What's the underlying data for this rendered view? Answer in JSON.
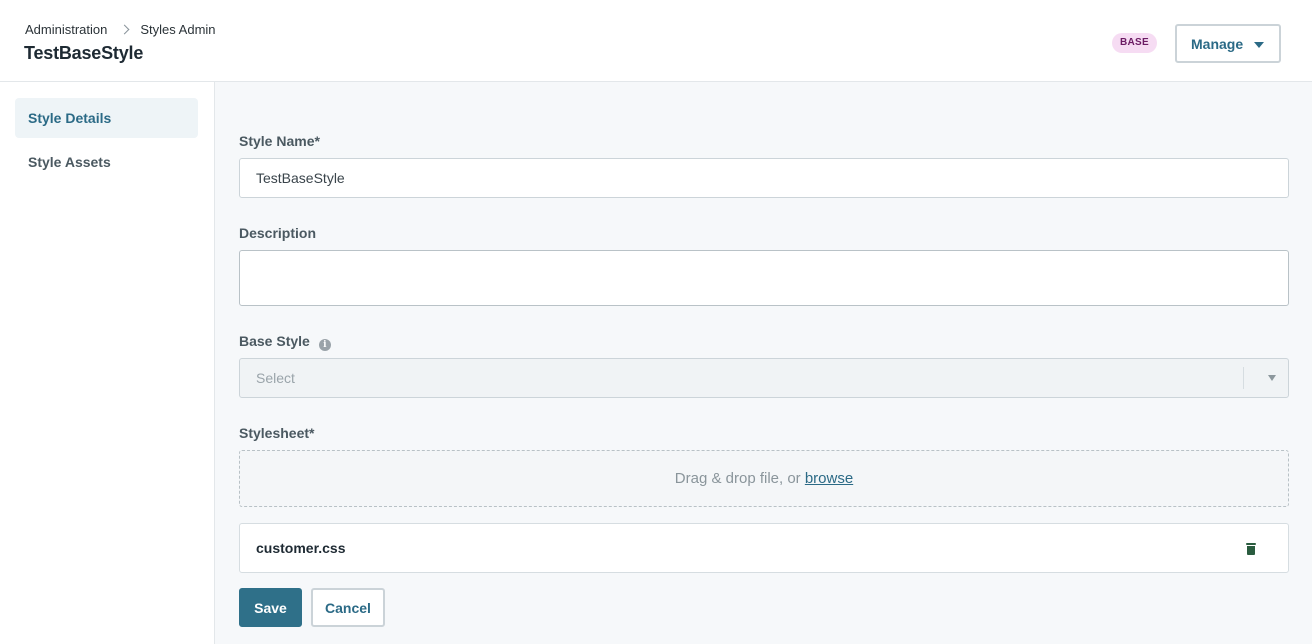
{
  "header": {
    "breadcrumb": [
      "Administration",
      "Styles Admin"
    ],
    "title": "TestBaseStyle",
    "badge": "BASE",
    "manage_label": "Manage"
  },
  "sidebar": {
    "items": [
      {
        "label": "Style Details",
        "active": true
      },
      {
        "label": "Style Assets",
        "active": false
      }
    ]
  },
  "form": {
    "style_name": {
      "label": "Style Name*",
      "value": "TestBaseStyle"
    },
    "description": {
      "label": "Description",
      "value": ""
    },
    "base_style": {
      "label": "Base Style",
      "placeholder": "Select",
      "icon": "info-icon"
    },
    "stylesheet": {
      "label": "Stylesheet*",
      "drop_text": "Drag & drop file, or",
      "browse_label": "browse",
      "file_name": "customer.css"
    },
    "save_label": "Save",
    "cancel_label": "Cancel"
  },
  "colors": {
    "accent": "#2f7089",
    "badge_bg": "#f6dcf3",
    "badge_text": "#6b1b63",
    "trash_icon": "#2a5c3f"
  }
}
